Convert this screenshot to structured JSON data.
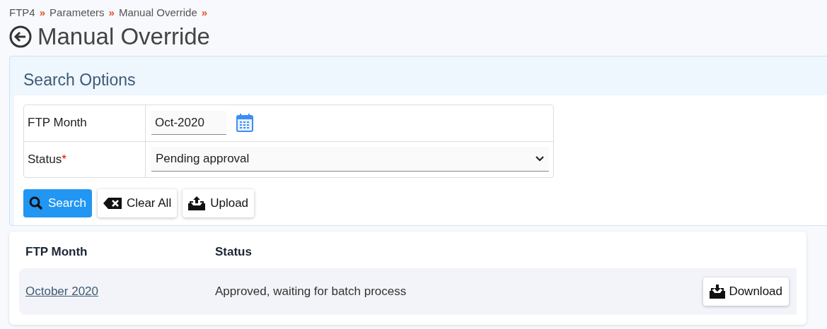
{
  "breadcrumb": [
    {
      "label": "FTP4",
      "separator": "»"
    },
    {
      "label": "Parameters",
      "separator": "»"
    },
    {
      "label": "Manual Override",
      "separator": "»"
    }
  ],
  "page_title": "Manual Override",
  "search_options": {
    "title": "Search Options",
    "fields": [
      {
        "kind": "date",
        "label": "FTP Month",
        "value": "Oct-2020"
      },
      {
        "kind": "select",
        "label": "Status",
        "required_marker": "*",
        "value": "Pending approval"
      }
    ],
    "buttons": [
      {
        "kind": "search",
        "label": "Search",
        "primary": true
      },
      {
        "kind": "clear",
        "label": "Clear All",
        "primary": false
      },
      {
        "kind": "upload",
        "label": "Upload",
        "primary": false
      }
    ]
  },
  "results": {
    "columns": [
      "FTP Month",
      "Status"
    ],
    "rows": [
      {
        "month": "October 2020",
        "status": "Approved, waiting for batch process",
        "action": "Download"
      }
    ]
  }
}
